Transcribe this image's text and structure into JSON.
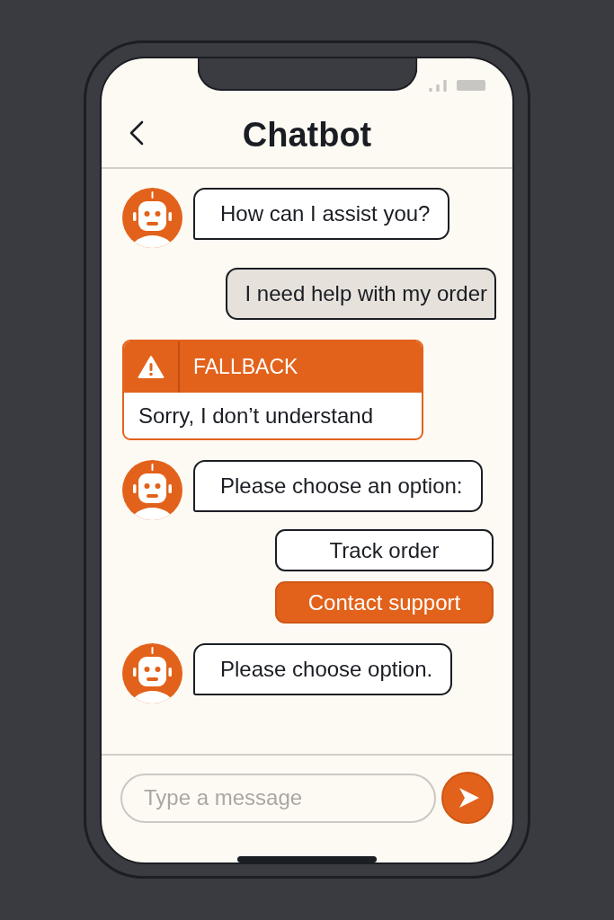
{
  "header": {
    "title": "Chatbot"
  },
  "messages": [
    {
      "kind": "bot",
      "text": "How can I assist you?"
    },
    {
      "kind": "user",
      "text": "I need help with my order"
    },
    {
      "kind": "fallback",
      "label": "FALLBACK",
      "text": "Sorry, I don’t understand"
    },
    {
      "kind": "bot",
      "text": "Please choose an option:"
    },
    {
      "kind": "options",
      "options": [
        {
          "label": "Track order",
          "selected": false
        },
        {
          "label": "Contact support",
          "selected": true
        }
      ]
    },
    {
      "kind": "bot",
      "text": "Please choose option."
    }
  ],
  "composer": {
    "placeholder": "Type a message"
  }
}
